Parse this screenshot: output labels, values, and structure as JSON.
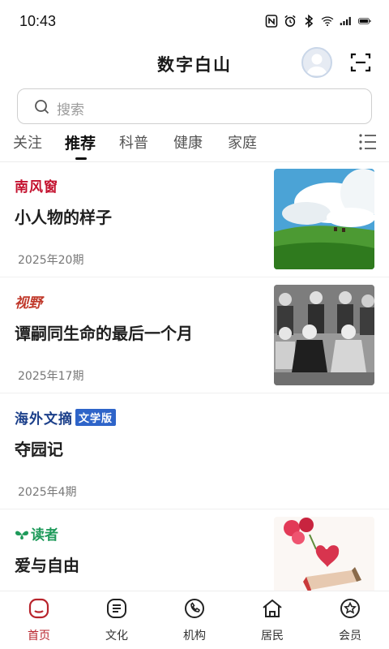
{
  "status_bar": {
    "time": "10:43"
  },
  "header": {
    "title": "数字白山"
  },
  "search": {
    "placeholder": "搜索"
  },
  "tabs": [
    {
      "label": "关注",
      "active": false
    },
    {
      "label": "推荐",
      "active": true
    },
    {
      "label": "科普",
      "active": false
    },
    {
      "label": "健康",
      "active": false
    },
    {
      "label": "家庭",
      "active": false
    }
  ],
  "feed": [
    {
      "source": "南风窗",
      "title": "小人物的样子",
      "issue": "2025年20期"
    },
    {
      "source": "视野",
      "title": "谭嗣同生命的最后一个月",
      "issue": "2025年17期"
    },
    {
      "source": "海外文摘",
      "source_badge": "文学版",
      "title": "夺园记",
      "issue": "2025年4期"
    },
    {
      "source": "读者",
      "title": "爱与自由",
      "issue": ""
    }
  ],
  "bottom_nav": [
    {
      "label": "首页",
      "icon": "home-icon",
      "active": true
    },
    {
      "label": "文化",
      "icon": "culture-icon",
      "active": false
    },
    {
      "label": "机构",
      "icon": "phone-icon",
      "active": false
    },
    {
      "label": "居民",
      "icon": "resident-icon",
      "active": false
    },
    {
      "label": "会员",
      "icon": "member-icon",
      "active": false
    }
  ],
  "colors": {
    "accent": "#b8242c",
    "tab_active": "#111111"
  }
}
